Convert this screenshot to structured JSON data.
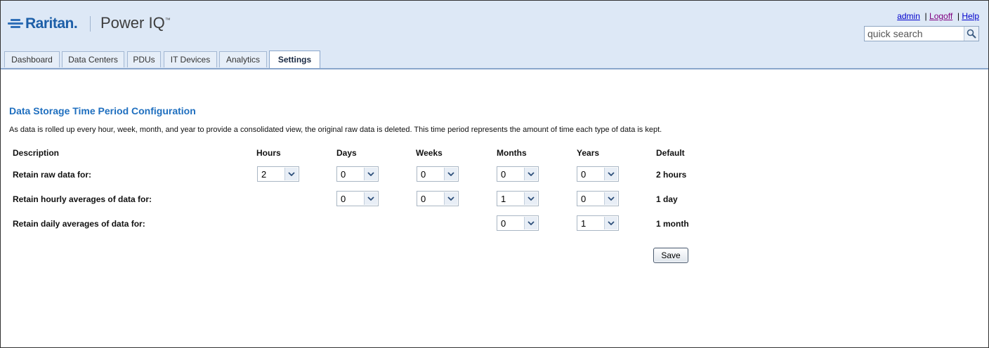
{
  "header": {
    "logo_text": "Raritan.",
    "product_name": "Power IQ",
    "product_tm": "™",
    "links": {
      "admin": "admin",
      "sep1": "|",
      "logoff": "Logoff",
      "sep2": "|",
      "help": "Help"
    },
    "search": {
      "placeholder": "quick search",
      "icon": "search-icon"
    }
  },
  "tabs": [
    {
      "label": "Dashboard"
    },
    {
      "label": "Data Centers"
    },
    {
      "label": "PDUs"
    },
    {
      "label": "IT Devices"
    },
    {
      "label": "Analytics"
    },
    {
      "label": "Settings",
      "active": true
    }
  ],
  "main": {
    "title": "Data Storage Time Period Configuration",
    "description": "As data is rolled up every hour, week, month, and year to provide a consolidated view, the original raw data is deleted. This time period represents the amount of time each type of data is kept.",
    "columns": [
      "Description",
      "Hours",
      "Days",
      "Weeks",
      "Months",
      "Years",
      "Default"
    ],
    "rows": [
      {
        "label": "Retain raw data for:",
        "hours": "2",
        "days": "0",
        "weeks": "0",
        "months": "0",
        "years": "0",
        "default": "2 hours"
      },
      {
        "label": "Retain hourly averages of data for:",
        "days": "0",
        "weeks": "0",
        "months": "1",
        "years": "0",
        "default": "1 day"
      },
      {
        "label": "Retain daily averages of data for:",
        "months": "0",
        "years": "1",
        "default": "1 month"
      }
    ],
    "save_label": "Save"
  },
  "colors": {
    "header_bg": "#dde8f6",
    "title": "#1f6fbf",
    "link": "#0000cc",
    "visited_link": "#800080"
  }
}
